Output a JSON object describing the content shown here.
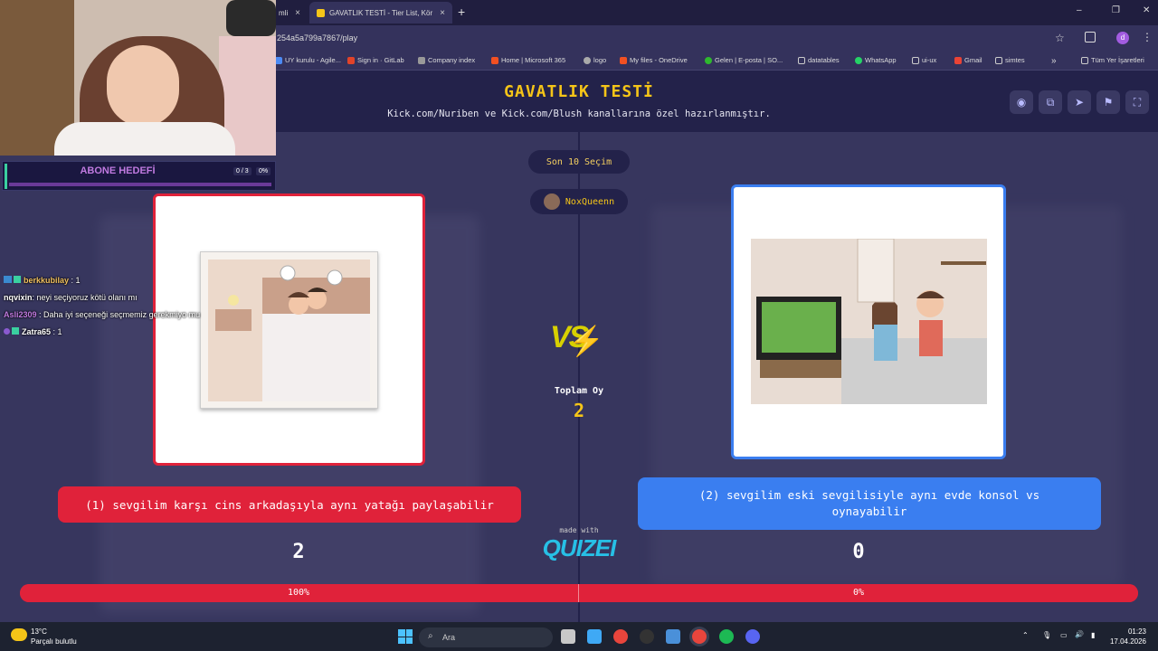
{
  "browser": {
    "tabs": [
      {
        "label": "mli",
        "close": "×"
      },
      {
        "label": "GAVATLIK TESTİ - Tier List, Kör",
        "close": "×"
      }
    ],
    "new_tab": "+",
    "url": "254a5a799a7867/play",
    "window_controls": {
      "minimize": "–",
      "restore": "❐",
      "close": "✕"
    },
    "bookmarks": [
      {
        "label": "UY kurulu - Agile...",
        "color": "#4c8bf5"
      },
      {
        "label": "Sign in · GitLab",
        "color": "#e24329"
      },
      {
        "label": "Company index",
        "color": "#999999"
      },
      {
        "label": "Home | Microsoft 365",
        "color": "#f25022"
      },
      {
        "label": "logo",
        "color": "#aaaaaa"
      },
      {
        "label": "My files - OneDrive",
        "color": "#f25022"
      },
      {
        "label": "Gelen | E-posta | SO...",
        "color": "#2eb82e"
      },
      {
        "label": "datatables",
        "color": "#cccccc"
      },
      {
        "label": "WhatsApp",
        "color": "#25d366"
      },
      {
        "label": "ui-ux",
        "color": "#cccccc"
      },
      {
        "label": "Gmail",
        "color": "#ea4335"
      },
      {
        "label": "simtes",
        "color": "#cccccc"
      }
    ],
    "bookmarks_more": "»",
    "all_bookmarks": "Tüm Yer İşaretleri"
  },
  "quiz": {
    "title": "GAVATLIK TESTİ",
    "subtitle": "Kick.com/Nuriben ve Kick.com/Blush kanallarına özel hazırlanmıştır.",
    "last_choices": "Son 10 Seçim",
    "user": "NoxQueenn",
    "vs": "VS",
    "total_votes_label": "Toplam Oy",
    "total_votes": "2",
    "option_left": "(1) sevgilim karşı cins arkadaşıyla aynı yatağı paylaşabilir",
    "option_right": "(2) sevgilim eski sevgilisiyle aynı evde konsol vs oynayabilir",
    "votes_left": "2",
    "votes_right": "0",
    "percent_left": "100%",
    "percent_right": "0%",
    "share_left": 1.0,
    "made_with": "made with",
    "brand": "QUIZEI",
    "colors": {
      "left": "#e0223a",
      "right": "#3a7ef0",
      "title": "#f5c518"
    }
  },
  "overlay": {
    "goal_title": "ABONE HEDEFİ",
    "goal_count": "0 / 3",
    "goal_percent": "0%"
  },
  "chat": [
    {
      "user": "berkkubilay",
      "text": ": 1",
      "color": "#f0c060"
    },
    {
      "user": "nqvixin",
      "text": ": neyi seçiyoruz kötü olanı mı",
      "color": "#ffffff"
    },
    {
      "user": "Asli2309",
      "text": ": Daha iyi seçeneği seçmemiz gerekmiyo mu",
      "color": "#c07ae0"
    },
    {
      "user": "Zatra65",
      "text": ": 1",
      "color": "#ffffff"
    }
  ],
  "taskbar": {
    "weather_temp": "13°C",
    "weather_desc": "Parçalı bulutlu",
    "search": "Ara",
    "time": "01:23",
    "date": "17.04.2026"
  }
}
